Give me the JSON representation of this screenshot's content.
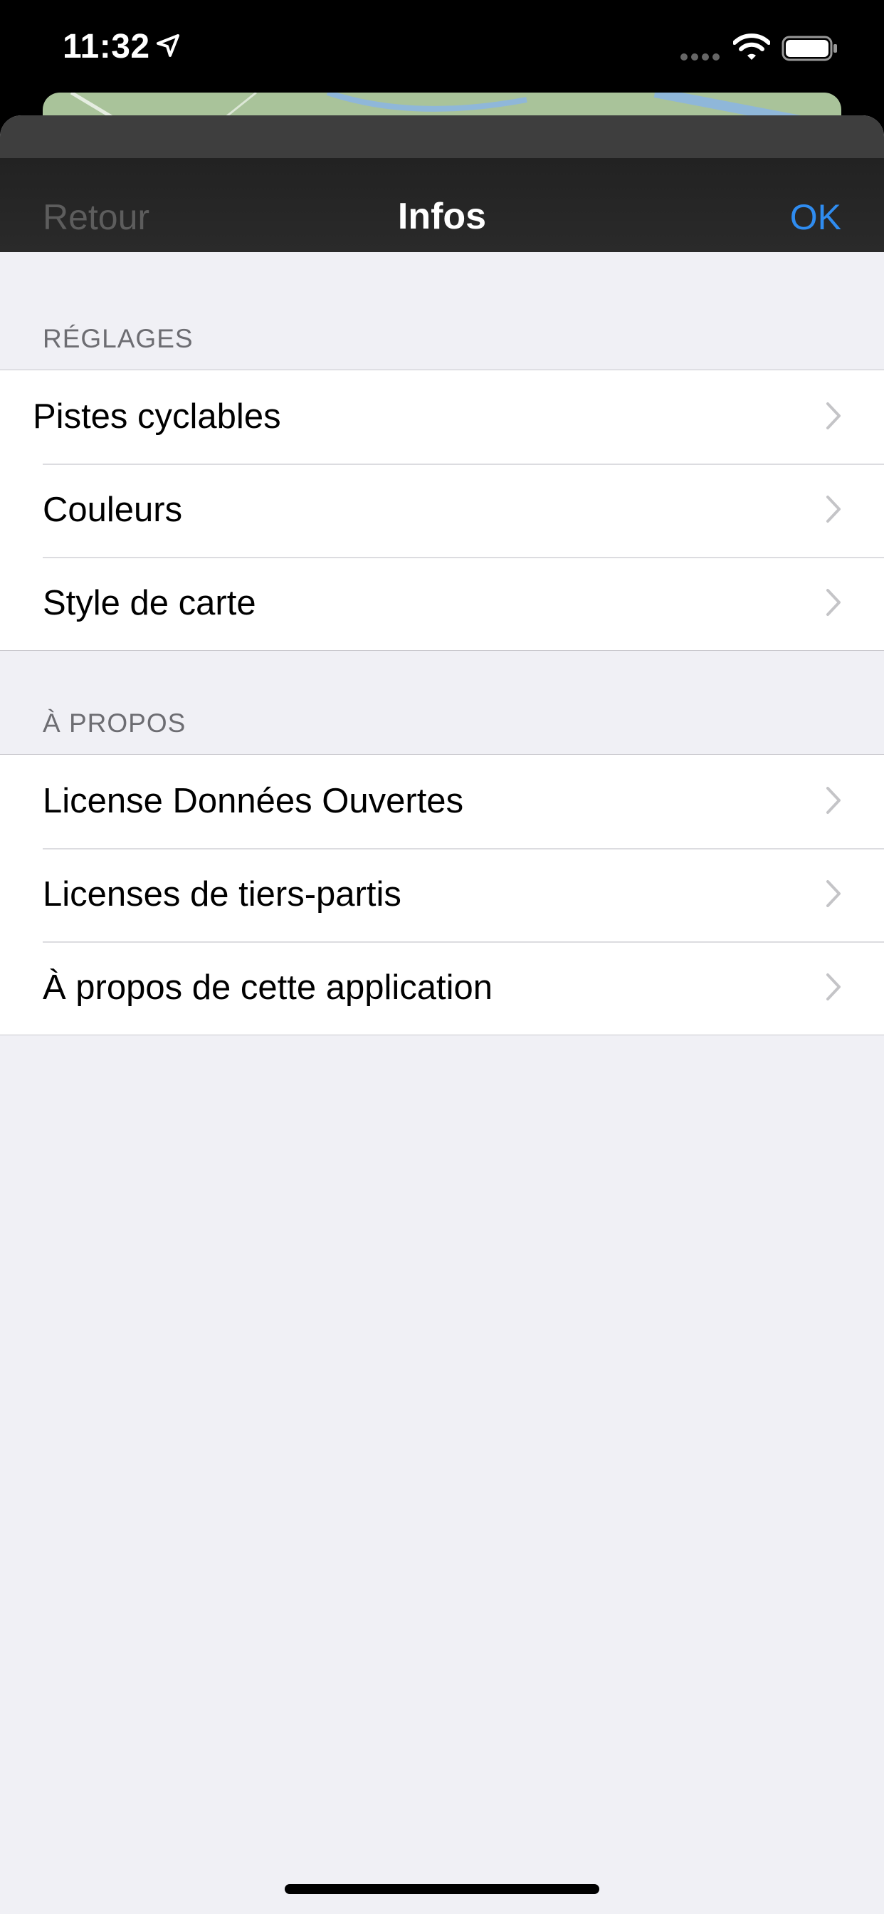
{
  "status": {
    "time": "11:32"
  },
  "nav": {
    "back": "Retour",
    "title": "Infos",
    "done": "OK"
  },
  "sections": [
    {
      "header": "RÉGLAGES",
      "items": [
        {
          "label": "Pistes cyclables"
        },
        {
          "label": "Couleurs"
        },
        {
          "label": "Style de carte"
        }
      ]
    },
    {
      "header": "À PROPOS",
      "items": [
        {
          "label": "License Données Ouvertes"
        },
        {
          "label": "Licenses de tiers-partis"
        },
        {
          "label": "À propos de cette application"
        }
      ]
    }
  ],
  "colors": {
    "accent": "#2f8cf0",
    "background": "#f0f0f5",
    "navbar": "#2a2a2a"
  }
}
